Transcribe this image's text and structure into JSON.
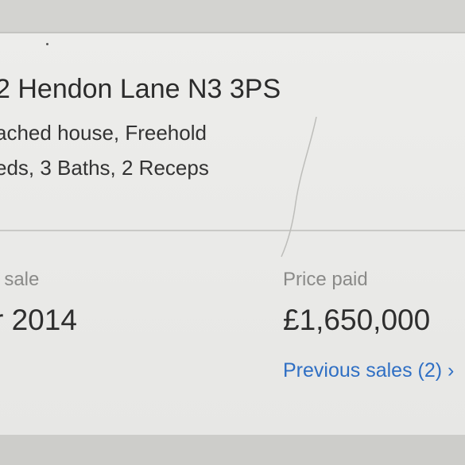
{
  "listing": {
    "address": "2 Hendon Lane N3 3PS",
    "property_type": "ached house, Freehold",
    "rooms": "eds, 3 Baths, 2 Receps"
  },
  "sale": {
    "date_label": "t sale",
    "date_value": "r 2014",
    "price_label": "Price paid",
    "price_value": "£1,650,000",
    "previous_sales_link": "Previous sales (2) ›"
  },
  "colors": {
    "link": "#2f6fc4",
    "text": "#2b2b2b",
    "muted": "#8a8a88",
    "card": "#ececea"
  }
}
